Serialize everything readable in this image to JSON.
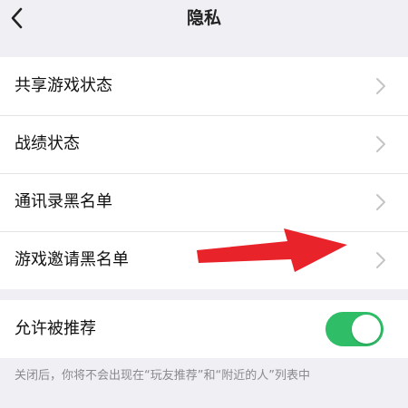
{
  "header": {
    "title": "隐私",
    "back_icon": "chevron-left-icon"
  },
  "privacy_list": {
    "items": [
      {
        "label": "共享游戏状态",
        "icon": "chevron-right-icon"
      },
      {
        "label": "战绩状态",
        "icon": "chevron-right-icon"
      },
      {
        "label": "通讯录黑名单",
        "icon": "chevron-right-icon"
      },
      {
        "label": "游戏邀请黑名单",
        "icon": "chevron-right-icon"
      }
    ]
  },
  "recommend": {
    "label": "允许被推荐",
    "toggle_on": true,
    "toggle_color": "#2fbd67"
  },
  "footer": {
    "note": "关闭后，你将不会出现在“玩友推荐”和“附近的人”列表中"
  },
  "annotation": {
    "arrow_color": "#e8232a"
  }
}
